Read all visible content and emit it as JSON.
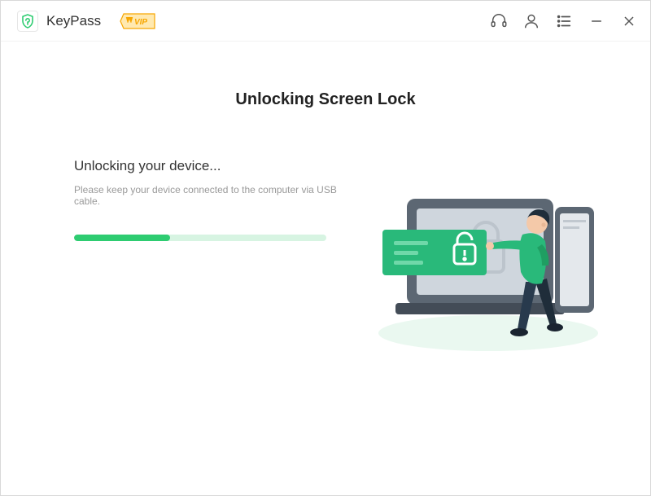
{
  "app": {
    "name": "KeyPass",
    "vip": "VIP"
  },
  "page": {
    "title": "Unlocking Screen Lock",
    "status": "Unlocking your device...",
    "hint": "Please keep your device connected to the computer via USB cable.",
    "progress_percent": 38
  },
  "colors": {
    "accent": "#2ecc71",
    "accent_light": "#d7f4e2",
    "vip_fill": "#f7a600",
    "vip_stroke": "#d88b00"
  }
}
